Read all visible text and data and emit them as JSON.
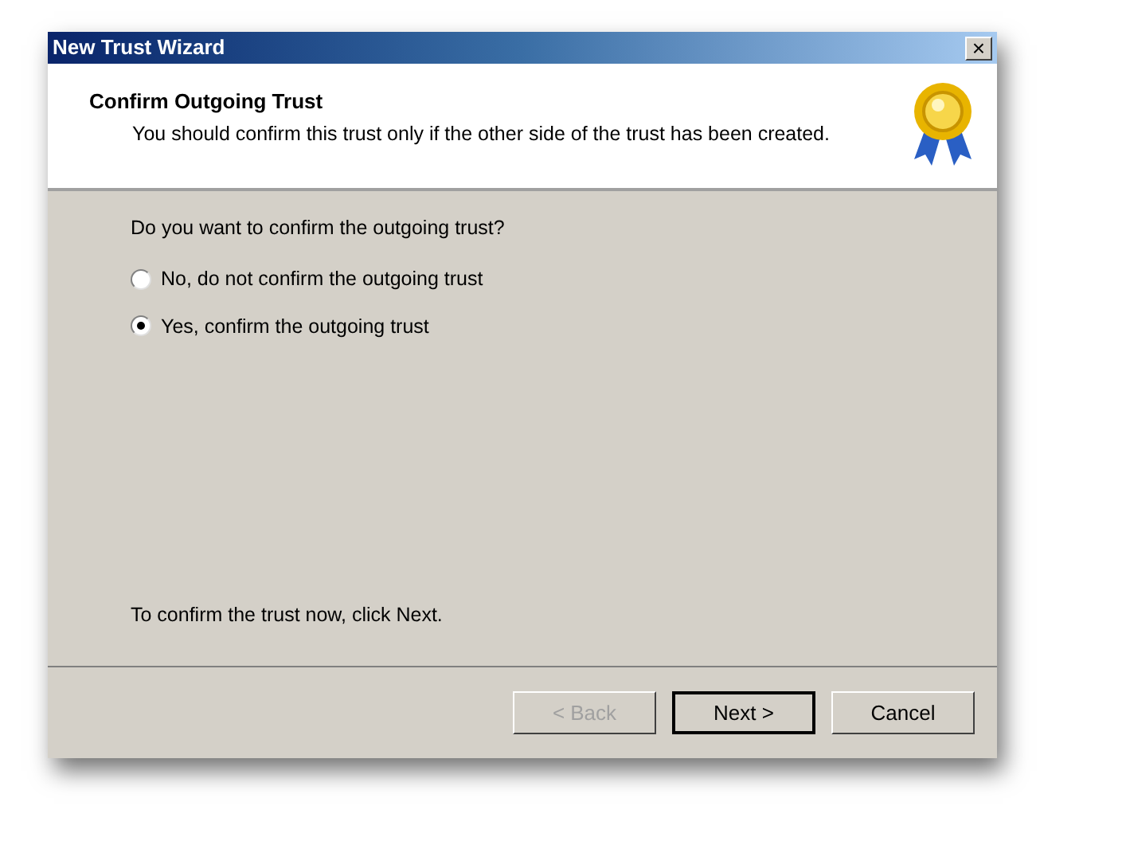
{
  "window": {
    "title": "New Trust Wizard",
    "close": "×"
  },
  "header": {
    "title": "Confirm Outgoing Trust",
    "subtitle": "You should confirm this trust only if the other side of the trust has been created."
  },
  "question": "Do you want to confirm the outgoing trust?",
  "options": [
    {
      "label": "No, do not confirm the outgoing trust",
      "selected": false
    },
    {
      "label": "Yes, confirm the outgoing trust",
      "selected": true
    }
  ],
  "instruction": "To confirm the trust now, click Next.",
  "buttons": [
    {
      "label": "< Back",
      "disabled": true,
      "default": false
    },
    {
      "label": "Next >",
      "disabled": false,
      "default": true
    },
    {
      "label": "Cancel",
      "disabled": false,
      "default": false
    }
  ]
}
